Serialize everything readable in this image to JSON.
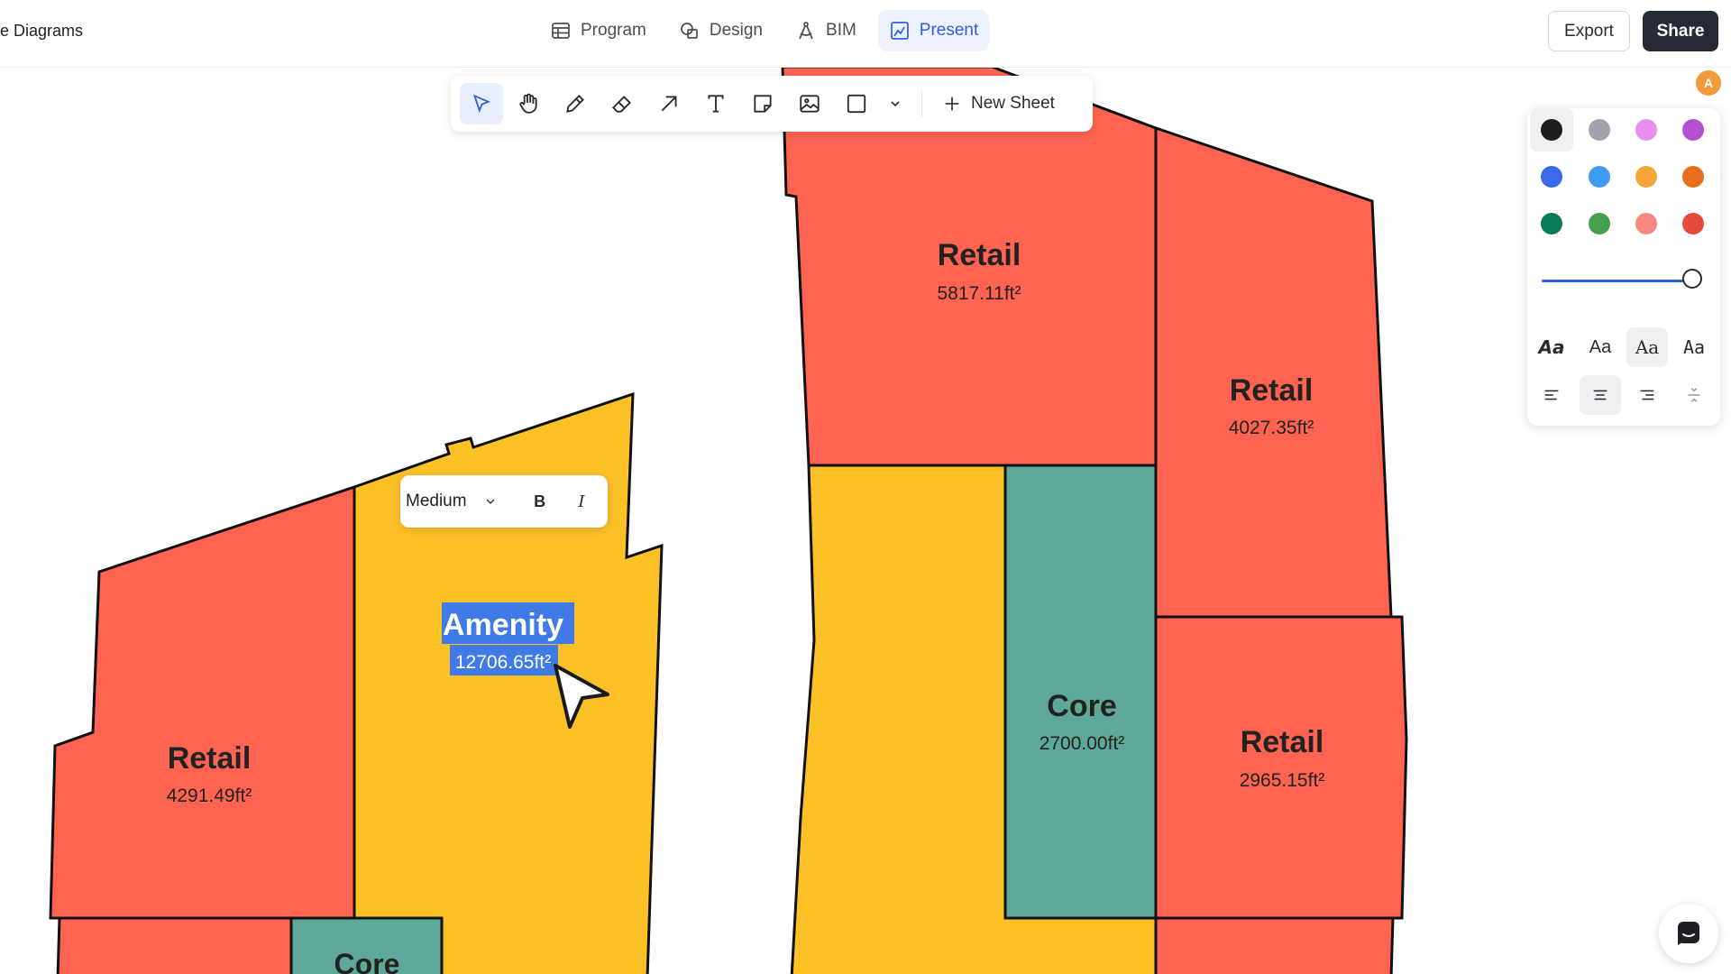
{
  "header": {
    "breadcrumb": "e Diagrams",
    "modes": [
      {
        "label": "Program",
        "icon": "table-icon"
      },
      {
        "label": "Design",
        "icon": "shapes-icon"
      },
      {
        "label": "BIM",
        "icon": "compass-icon"
      },
      {
        "label": "Present",
        "icon": "present-icon",
        "active": true
      }
    ],
    "export_label": "Export",
    "share_label": "Share"
  },
  "toolbar": {
    "tools": [
      "select-tool",
      "hand-tool",
      "pencil-tool",
      "eraser-tool",
      "arrow-tool",
      "text-tool",
      "note-tool",
      "image-tool",
      "rectangle-tool",
      "more-tools"
    ],
    "active_tool": "select-tool",
    "new_sheet_label": "New Sheet"
  },
  "avatar_initial": "A",
  "properties_panel": {
    "colors": [
      "#1e1e1e",
      "#a0a3ab",
      "#e88ef0",
      "#b64fcf",
      "#3b6ae8",
      "#3e9cf0",
      "#f5a53a",
      "#e86e1a",
      "#0b7a5a",
      "#44a04f",
      "#f58a80",
      "#e84a3a"
    ],
    "selected_color": "#1e1e1e",
    "stroke_width_fraction": 1.0,
    "font_options": [
      "Aa",
      "Aa",
      "Aa",
      "Aa"
    ],
    "active_font_index": 2,
    "align_options": [
      "align-left-icon",
      "align-center-icon",
      "align-right-icon",
      "align-vertical-icon"
    ],
    "active_align_index": 1
  },
  "text_toolbar": {
    "size_value": "Medium",
    "bold_label": "B",
    "italic_label": "I"
  },
  "rooms": [
    {
      "id": "retail-top",
      "label": "Retail",
      "area": "5817.11ft²"
    },
    {
      "id": "retail-right-upper",
      "label": "Retail",
      "area": "4027.35ft²"
    },
    {
      "id": "core-right",
      "label": "Core",
      "area": "2700.00ft²"
    },
    {
      "id": "retail-right-lower",
      "label": "Retail",
      "area": "2965.15ft²"
    },
    {
      "id": "amenity",
      "label": "Amenity",
      "area": "12706.65ft²"
    },
    {
      "id": "retail-left",
      "label": "Retail",
      "area": "4291.49ft²"
    },
    {
      "id": "core-left",
      "label": "Core"
    }
  ],
  "colors": {
    "retail": "#ff6352",
    "amenity": "#fdc128",
    "core": "#5ea899",
    "accent": "#2f5ee0",
    "selection": "#3f7ae6"
  }
}
